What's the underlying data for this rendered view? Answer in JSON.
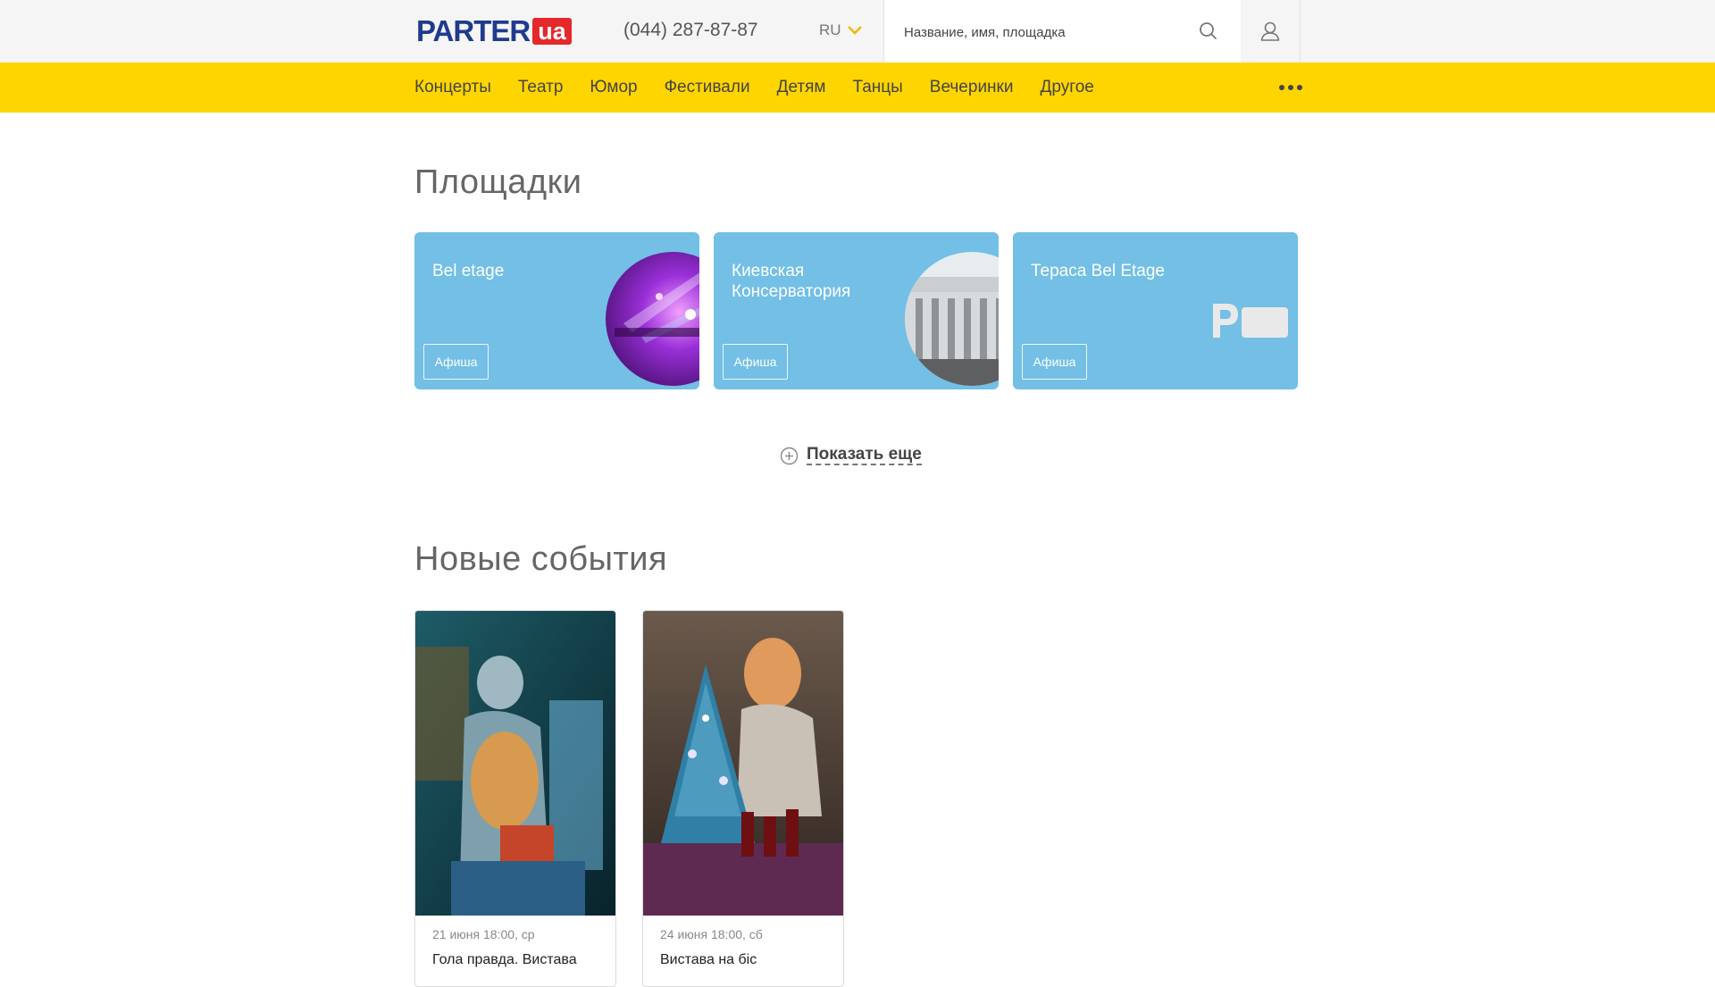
{
  "header": {
    "logo_text": "PARTER",
    "logo_badge": "ua",
    "phone": "(044) 287-87-87",
    "language": "RU",
    "search_placeholder": "Название, имя, площадка"
  },
  "nav": {
    "items": [
      "Концерты",
      "Театр",
      "Юмор",
      "Фестивали",
      "Детям",
      "Танцы",
      "Вечеринки",
      "Другое"
    ]
  },
  "venues": {
    "title": "Площадки",
    "items": [
      {
        "name": "Bel etage",
        "button": "Афиша"
      },
      {
        "name": "Киевская Консерватория",
        "button": "Афиша"
      },
      {
        "name": "Тераса Bel Etage",
        "button": "Афиша"
      }
    ],
    "show_more": "Показать еще"
  },
  "events": {
    "title": "Новые события",
    "items": [
      {
        "date": "21 июня 18:00, ср",
        "title": "Гола правда. Вистава"
      },
      {
        "date": "24 июня 18:00, сб",
        "title": "Вистава на біс"
      }
    ]
  },
  "colors": {
    "nav_yellow": "#ffd500",
    "card_blue": "#73bfe6",
    "logo_blue": "#1f3b8f",
    "logo_red": "#e4282b"
  }
}
